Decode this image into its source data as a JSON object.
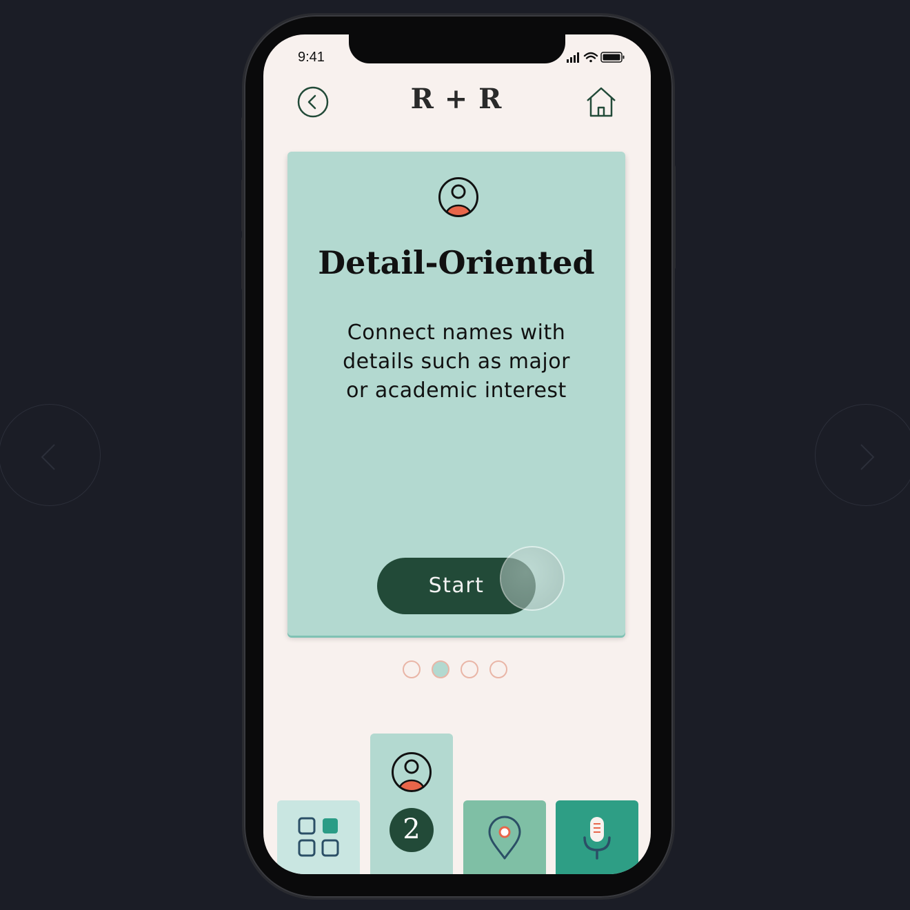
{
  "status_bar": {
    "time": "9:41"
  },
  "header": {
    "title": "R + R"
  },
  "card": {
    "title": "Detail-Oriented",
    "description": "Connect names with details such as major or academic interest",
    "start_label": "Start"
  },
  "pagination": {
    "count": 4,
    "active_index": 1
  },
  "tab_bar": {
    "profile_badge": "2",
    "tabs": [
      "grid-icon",
      "profile-icon",
      "map-pin-icon",
      "microphone-icon"
    ]
  },
  "colors": {
    "background": "#1b1d26",
    "screen": "#f8f1ee",
    "card": "#b3d9d0",
    "dark_green": "#224a38",
    "accent_orange": "#e8664a",
    "dot_border": "#e9b5a6"
  }
}
